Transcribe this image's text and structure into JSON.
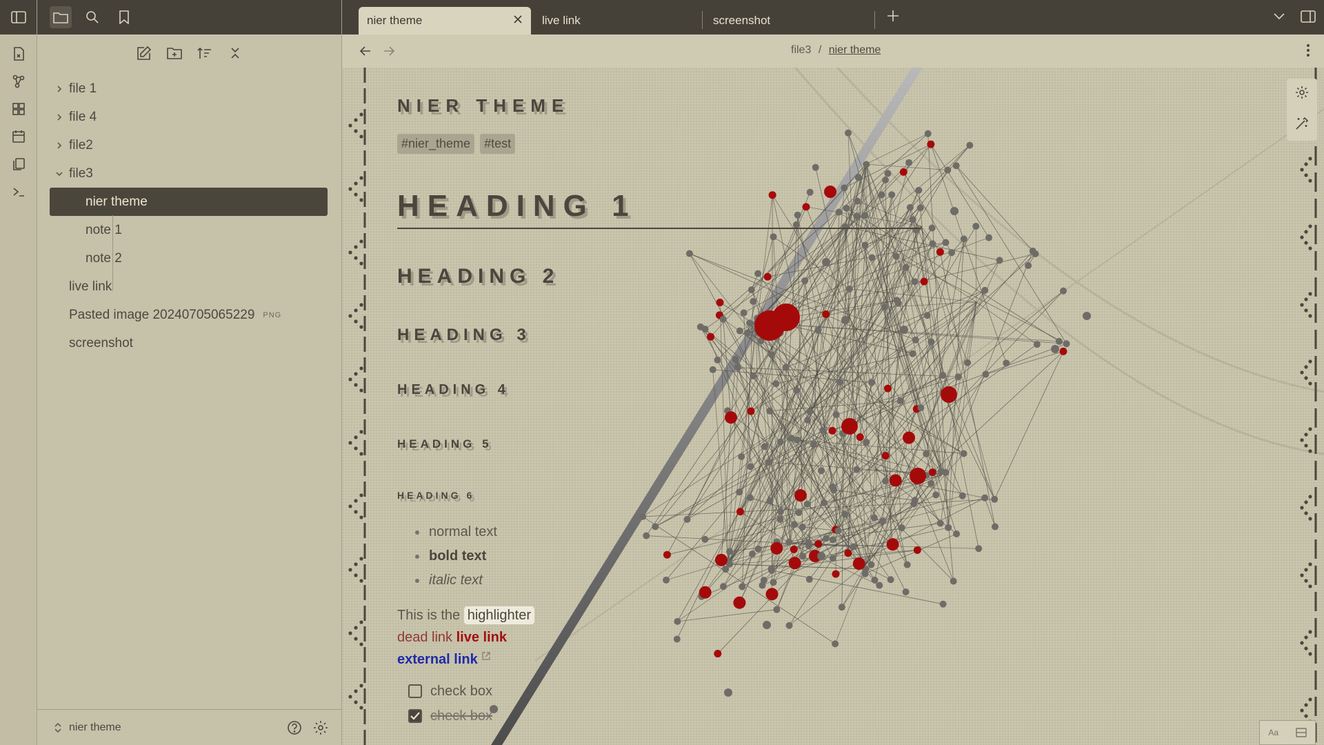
{
  "app": {
    "accent": "#a50a0a",
    "ink": "#4a463d"
  },
  "ribbon": {
    "icons": [
      "sidebar-toggle-icon",
      "switcher-icon",
      "graph-icon",
      "canvas-icon",
      "calendar-icon",
      "templates-icon",
      "terminal-icon"
    ]
  },
  "sidebar": {
    "tree": [
      {
        "label": "file 1",
        "type": "folder",
        "expanded": false
      },
      {
        "label": "file 4",
        "type": "folder",
        "expanded": false
      },
      {
        "label": "file2",
        "type": "folder",
        "expanded": false
      },
      {
        "label": "file3",
        "type": "folder",
        "expanded": true
      },
      {
        "label": "nier theme",
        "type": "note",
        "selected": true
      },
      {
        "label": "note 1",
        "type": "note"
      },
      {
        "label": "note 2",
        "type": "note"
      },
      {
        "label": "live link",
        "type": "note"
      },
      {
        "label": "Pasted image 20240705065229",
        "ext": "PNG",
        "type": "file"
      },
      {
        "label": "screenshot",
        "type": "note"
      }
    ],
    "vault_name": "nier theme"
  },
  "tabs": [
    {
      "label": "nier theme",
      "active": true
    },
    {
      "label": "live link"
    },
    {
      "label": "screenshot"
    }
  ],
  "breadcrumb": {
    "parent": "file3",
    "separator": "/",
    "current": "nier theme"
  },
  "doc": {
    "title": "NIER THEME",
    "tags": [
      "#nier_theme",
      "#test"
    ],
    "headings": [
      "HEADING 1",
      "HEADING 2",
      "HEADING 3",
      "HEADING 4",
      "HEADING 5",
      "HEADING 6"
    ],
    "bullets": {
      "normal": "normal text",
      "bold": "bold text",
      "italic": "italic text"
    },
    "para": {
      "prefix": "This is the",
      "highlight": "highlighter",
      "dead": "dead link",
      "live": "live link",
      "external": "external link"
    },
    "checks": [
      {
        "label": "check box",
        "done": false
      },
      {
        "label": "check box",
        "done": true
      }
    ]
  },
  "status": {
    "font_label": "Aa"
  }
}
